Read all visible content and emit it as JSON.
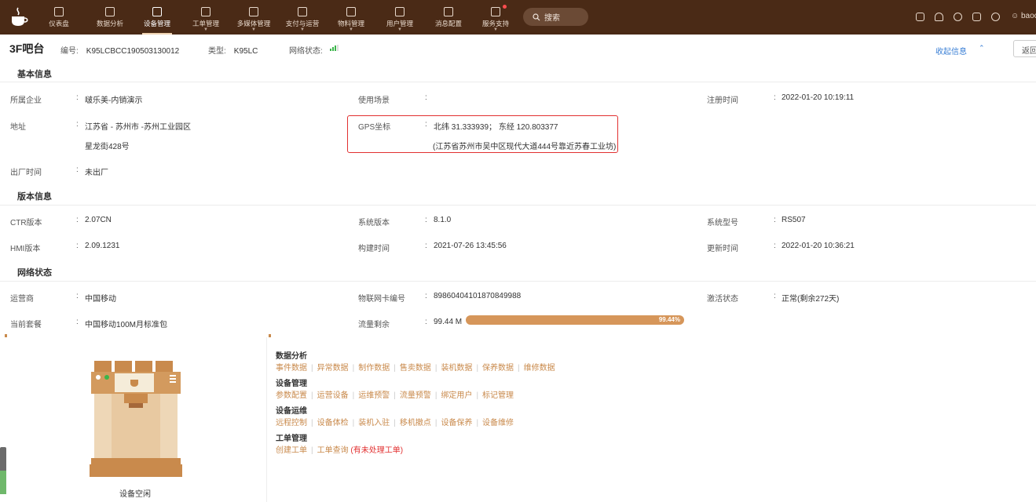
{
  "nav": {
    "items": [
      {
        "label": "仪表盘",
        "icon": "gauge-icon",
        "active": false,
        "caret": false,
        "badge": false
      },
      {
        "label": "数据分析",
        "icon": "chart-icon",
        "active": false,
        "caret": false,
        "badge": false
      },
      {
        "label": "设备管理",
        "icon": "device-icon",
        "active": true,
        "caret": false,
        "badge": false
      },
      {
        "label": "工单管理",
        "icon": "ticket-icon",
        "active": false,
        "caret": true,
        "badge": false
      },
      {
        "label": "多媒体管理",
        "icon": "media-icon",
        "active": false,
        "caret": true,
        "badge": false
      },
      {
        "label": "支付与运营",
        "icon": "payment-icon",
        "active": false,
        "caret": true,
        "badge": false
      },
      {
        "label": "物料管理",
        "icon": "box-icon",
        "active": false,
        "caret": true,
        "badge": false
      },
      {
        "label": "用户管理",
        "icon": "user-icon",
        "active": false,
        "caret": true,
        "badge": false
      },
      {
        "label": "消息配置",
        "icon": "message-icon",
        "active": false,
        "caret": false,
        "badge": false
      },
      {
        "label": "服务支持",
        "icon": "support-icon",
        "active": false,
        "caret": true,
        "badge": true
      }
    ],
    "search_label": "搜索",
    "user_name": "baoc",
    "tool_icons": [
      "wrench-icon",
      "bell-icon",
      "headset-icon",
      "copy-icon",
      "globe-icon"
    ]
  },
  "header": {
    "device_name": "3F吧台",
    "serial_label": "编号:",
    "serial_value": "K95LCBCC190503130012",
    "type_label": "类型:",
    "type_value": "K95LC",
    "network_label": "网络状态:",
    "collapse_label": "收起信息",
    "back_label": "返回"
  },
  "basic": {
    "title": "基本信息",
    "company_label": "所属企业",
    "company_value": "啵乐美-内销演示",
    "scene_label": "使用场景",
    "scene_value": "",
    "reg_label": "注册时间",
    "reg_value": "2022-01-20 10:19:11",
    "address_label": "地址",
    "address_line1": "江苏省 - 苏州市 -苏州工业园区",
    "address_line2": "星龙街428号",
    "gps_label": "GPS坐标",
    "gps_value": "北纬 31.333939； 东经 120.803377",
    "gps_address": "(江苏省苏州市吴中区现代大道444号靠近苏春工业坊)",
    "factory_label": "出厂时间",
    "factory_value": "未出厂"
  },
  "version": {
    "title": "版本信息",
    "ctr_label": "CTR版本",
    "ctr_value": "2.07CN",
    "sys_label": "系统版本",
    "sys_value": "8.1.0",
    "model_label": "系统型号",
    "model_value": "RS507",
    "hmi_label": "HMI版本",
    "hmi_value": "2.09.1231",
    "build_label": "构建时间",
    "build_value": "2021-07-26 13:45:56",
    "update_label": "更新时间",
    "update_value": "2022-01-20 10:36:21"
  },
  "network": {
    "title": "网络状态",
    "carrier_label": "运营商",
    "carrier_value": "中国移动",
    "sim_label": "物联网卡编号",
    "sim_value": "89860404101870849988",
    "activate_label": "激活状态",
    "activate_value": "正常(剩余272天)",
    "plan_label": "当前套餐",
    "plan_value": "中国移动100M月标准包",
    "traffic_label": "流量剩余",
    "traffic_value": "99.44 M",
    "traffic_percent_text": "99.44%",
    "traffic_fraction": 0.9944
  },
  "device_status": "设备空闲",
  "functions": [
    {
      "title": "数据分析",
      "links": [
        "事件数据",
        "异常数据",
        "制作数据",
        "售卖数据",
        "装机数据",
        "保养数据",
        "维修数据"
      ]
    },
    {
      "title": "设备管理",
      "links": [
        "参数配置",
        "运营设备",
        "运维预警",
        "流量预警",
        "绑定用户",
        "标记管理"
      ]
    },
    {
      "title": "设备运维",
      "links": [
        "远程控制",
        "设备体检",
        "装机入驻",
        "移机撤点",
        "设备保养",
        "设备维修"
      ]
    },
    {
      "title": "工单管理",
      "links": [
        "创建工单",
        "工单查询"
      ],
      "warning": "(有未处理工单)"
    }
  ],
  "colors": {
    "nav_bg": "#4a2a16",
    "accent": "#c98a4c",
    "progress": "#d6965a",
    "highlight_border": "#e23030",
    "link_blue": "#3a7fd5"
  }
}
